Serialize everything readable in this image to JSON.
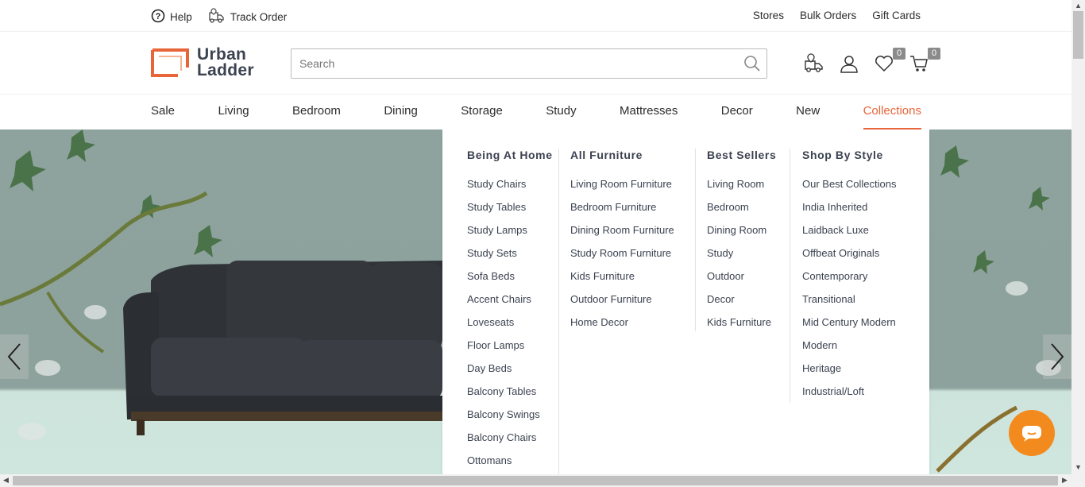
{
  "topbar": {
    "help": "Help",
    "track_order": "Track Order",
    "stores": "Stores",
    "bulk_orders": "Bulk Orders",
    "gift_cards": "Gift Cards"
  },
  "header": {
    "logo_line1": "Urban",
    "logo_line2": "Ladder",
    "search_placeholder": "Search",
    "wishlist_count": "0",
    "cart_count": "0"
  },
  "nav": {
    "items": [
      "Sale",
      "Living",
      "Bedroom",
      "Dining",
      "Storage",
      "Study",
      "Mattresses",
      "Decor",
      "New",
      "Collections"
    ],
    "active": "Collections"
  },
  "dropdown": {
    "columns": [
      {
        "title": "Being At Home",
        "links": [
          "Study Chairs",
          "Study Tables",
          "Study Lamps",
          "Study Sets",
          "Sofa Beds",
          "Accent Chairs",
          "Loveseats",
          "Floor Lamps",
          "Day Beds",
          "Balcony Tables",
          "Balcony Swings",
          "Balcony Chairs",
          "Ottomans"
        ]
      },
      {
        "title": "All Furniture",
        "links": [
          "Living Room Furniture",
          "Bedroom Furniture",
          "Dining Room Furniture",
          "Study Room Furniture",
          "Kids Furniture",
          "Outdoor Furniture",
          "Home Decor"
        ]
      },
      {
        "title": "Best Sellers",
        "links": [
          "Living Room",
          "Bedroom",
          "Dining Room",
          "Study",
          "Outdoor",
          "Decor",
          "Kids Furniture"
        ]
      },
      {
        "title": "Shop By Style",
        "links": [
          "Our Best Collections",
          "India Inherited",
          "Laidback Luxe",
          "Offbeat Originals",
          "Contemporary",
          "Transitional",
          "Mid Century Modern",
          "Modern",
          "Heritage",
          "Industrial/Loft"
        ]
      }
    ]
  },
  "colors": {
    "accent": "#e8653a",
    "chat": "#f38a1e",
    "text": "#3b4250"
  }
}
